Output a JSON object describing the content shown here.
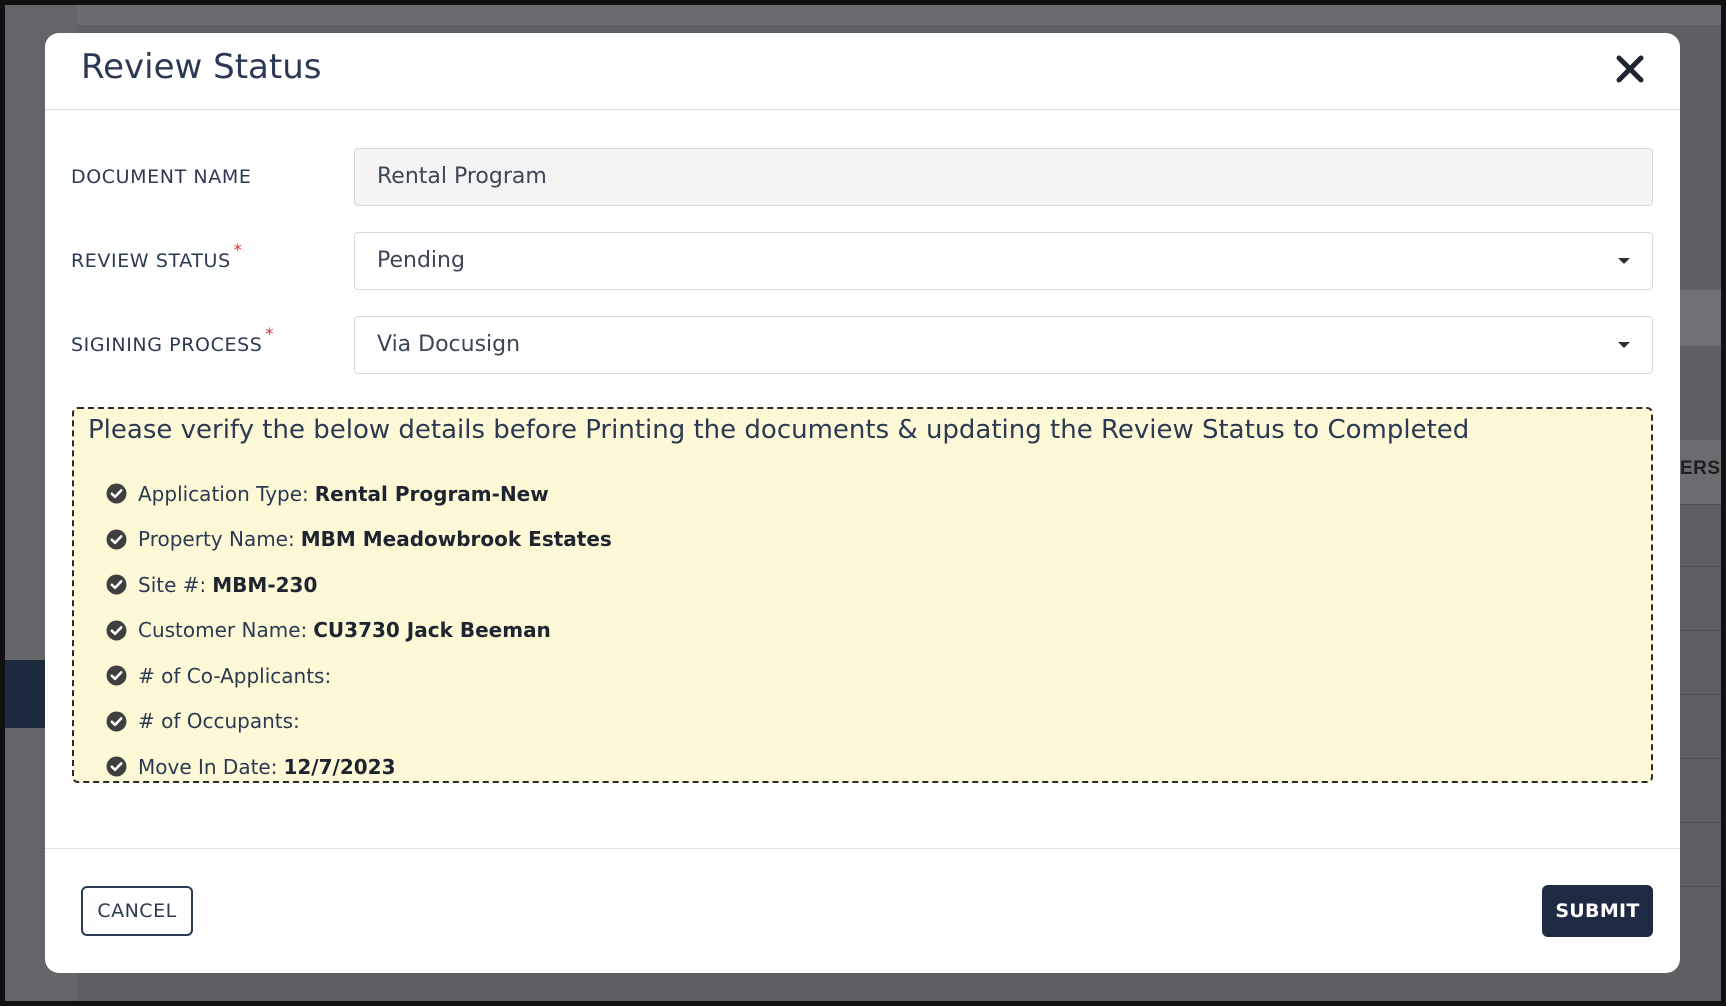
{
  "background": {
    "partial_column_header": "ERS"
  },
  "modal": {
    "title": "Review Status",
    "close_icon": "close-icon"
  },
  "form": {
    "document_name": {
      "label": "DOCUMENT NAME",
      "value": "Rental Program",
      "required": false
    },
    "review_status": {
      "label": "REVIEW STATUS",
      "value": "Pending",
      "required": true,
      "required_marker": "*"
    },
    "signing_process": {
      "label": "SIGINING PROCESS",
      "value": "Via Docusign",
      "required": true,
      "required_marker": "*"
    }
  },
  "notice": {
    "title": "Please verify the below details before Printing the documents & updating the Review Status to Completed",
    "icon": "check-circle-icon",
    "items": [
      {
        "label": "Application Type:",
        "value": "Rental Program-New"
      },
      {
        "label": "Property Name:",
        "value": "MBM Meadowbrook Estates"
      },
      {
        "label": "Site #:",
        "value": "MBM-230"
      },
      {
        "label": "Customer Name:",
        "value": "CU3730 Jack Beeman"
      },
      {
        "label": "# of Co-Applicants:",
        "value": ""
      },
      {
        "label": "# of Occupants:",
        "value": ""
      },
      {
        "label": "Move In Date:",
        "value": "12/7/2023"
      }
    ]
  },
  "footer": {
    "cancel_label": "CANCEL",
    "submit_label": "SUBMIT"
  },
  "colors": {
    "primary": "#1f2b42",
    "text": "#2b3a52",
    "required": "#e0283c",
    "notice_bg": "#fdf8d6",
    "overlay": "#5e5f63"
  }
}
